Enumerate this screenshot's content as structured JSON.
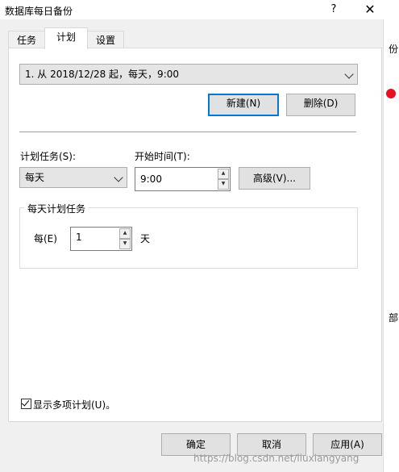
{
  "window": {
    "title": "数据库每日备份",
    "help_label": "?",
    "close_label": "✕"
  },
  "tabs": [
    {
      "label": "任务"
    },
    {
      "label": "计划"
    },
    {
      "label": "设置"
    }
  ],
  "schedule": {
    "selected": "1. 从 2018/12/28 起，每天，9:00",
    "new_label": "新建(N)",
    "delete_label": "删除(D)"
  },
  "task": {
    "schedule_task_label": "计划任务(S):",
    "schedule_task_value": "每天",
    "start_time_label": "开始时间(T):",
    "start_time_value": "9:00",
    "advanced_label": "高级(V)..."
  },
  "daily": {
    "group_title": "每天计划任务",
    "every_label": "每(E)",
    "every_value": "1",
    "unit_label": "天"
  },
  "show_multiple": {
    "label": "显示多项计划(U)。",
    "checked": true
  },
  "footer": {
    "ok_label": "确定",
    "cancel_label": "取消",
    "apply_label": "应用(A)"
  },
  "background": {
    "edge_text_1": "份",
    "edge_text_2": "部"
  },
  "watermark": "https://blog.csdn.net/liuxiangyang"
}
